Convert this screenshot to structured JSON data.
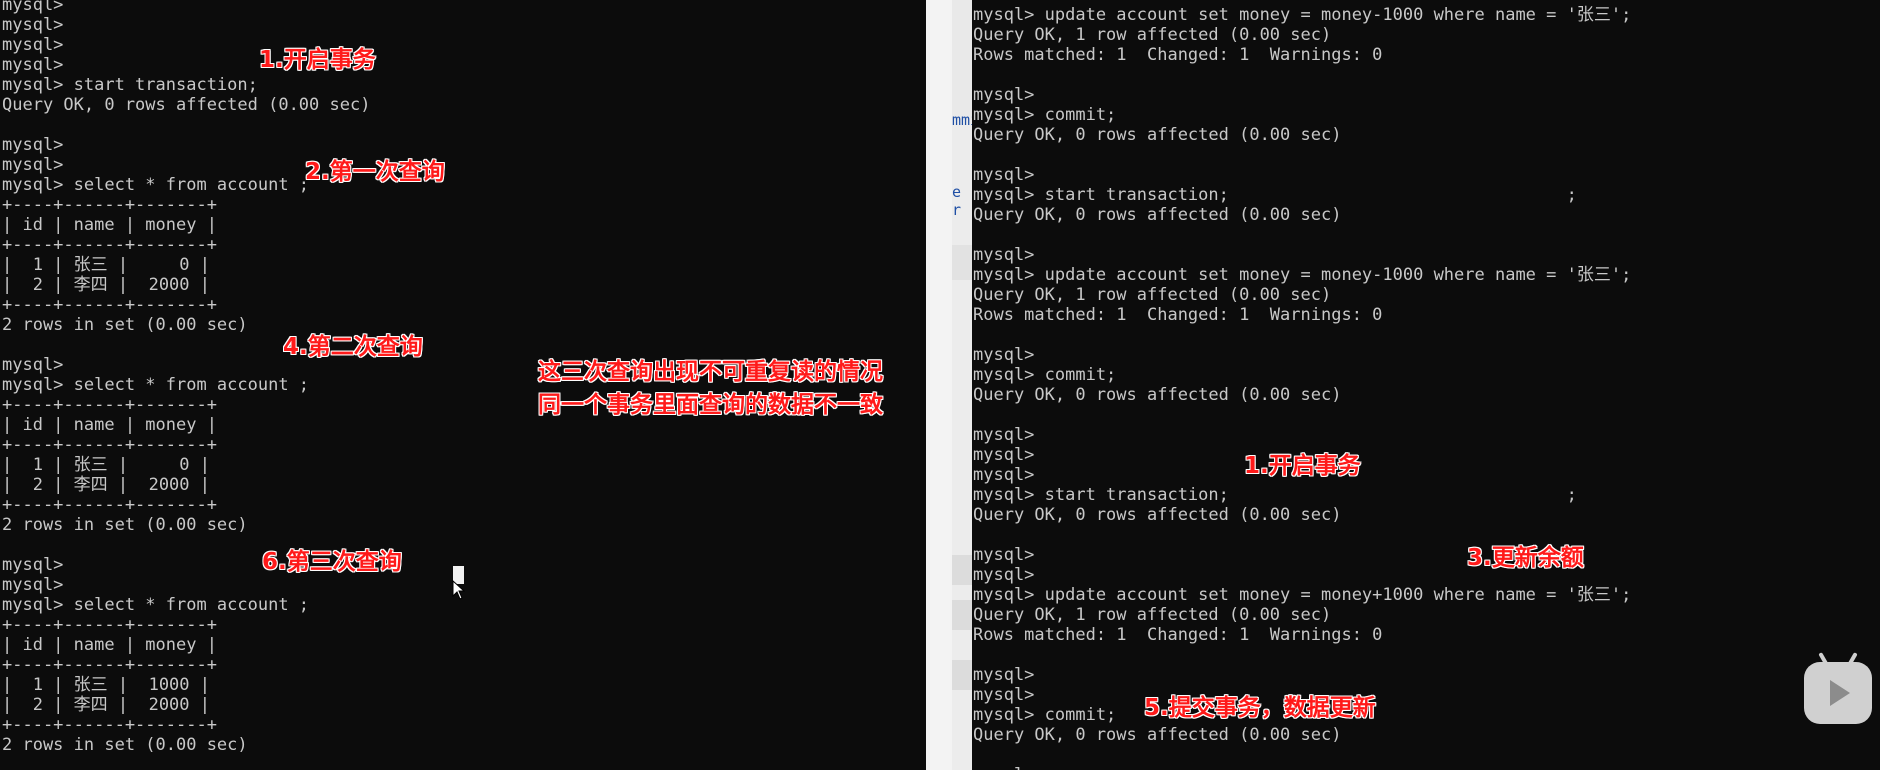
{
  "left_terminal": {
    "lines": [
      "mysql>",
      "mysql>",
      "mysql>",
      "mysql>",
      "mysql> start transaction;",
      "Query OK, 0 rows affected (0.00 sec)",
      "",
      "mysql>",
      "mysql>",
      "mysql> select * from account ;",
      "+----+------+-------+",
      "| id | name | money |",
      "+----+------+-------+",
      "|  1 | 张三 |     0 |",
      "|  2 | 李四 |  2000 |",
      "+----+------+-------+",
      "2 rows in set (0.00 sec)",
      "",
      "mysql>",
      "mysql> select * from account ;",
      "+----+------+-------+",
      "| id | name | money |",
      "+----+------+-------+",
      "|  1 | 张三 |     0 |",
      "|  2 | 李四 |  2000 |",
      "+----+------+-------+",
      "2 rows in set (0.00 sec)",
      "",
      "mysql>",
      "mysql>",
      "mysql> select * from account ;",
      "+----+------+-------+",
      "| id | name | money |",
      "+----+------+-------+",
      "|  1 | 张三 |  1000 |",
      "|  2 | 李四 |  2000 |",
      "+----+------+-------+",
      "2 rows in set (0.00 sec)",
      "",
      "mysql>"
    ]
  },
  "right_terminal": {
    "lines": [
      "mysql> update account set money = money-1000 where name = '张三';",
      "Query OK, 1 row affected (0.00 sec)",
      "Rows matched: 1  Changed: 1  Warnings: 0",
      "",
      "mysql>",
      "mysql> commit;",
      "Query OK, 0 rows affected (0.00 sec)",
      "",
      "mysql>",
      "mysql> start transaction;                                 ;",
      "Query OK, 0 rows affected (0.00 sec)",
      "",
      "mysql>",
      "mysql> update account set money = money-1000 where name = '张三';",
      "Query OK, 1 row affected (0.00 sec)",
      "Rows matched: 1  Changed: 1  Warnings: 0",
      "",
      "mysql>",
      "mysql> commit;",
      "Query OK, 0 rows affected (0.00 sec)",
      "",
      "mysql>",
      "mysql>",
      "mysql>",
      "mysql> start transaction;                                 ;",
      "Query OK, 0 rows affected (0.00 sec)",
      "",
      "mysql>",
      "mysql>",
      "mysql> update account set money = money+1000 where name = '张三';",
      "Query OK, 1 row affected (0.00 sec)",
      "Rows matched: 1  Changed: 1  Warnings: 0",
      "",
      "mysql>",
      "mysql>",
      "mysql> commit;",
      "Query OK, 0 rows affected (0.00 sec)",
      "",
      "mysql>"
    ]
  },
  "editor_fragments": [
    "mmi",
    "e r"
  ],
  "annotations": {
    "left": [
      "1.开启事务",
      "2.第一次查询",
      "4.第二次查询",
      "6.第三次查询",
      "这三次查询出现不可重复读的情况",
      "同一个事务里面查询的数据不一致"
    ],
    "right": [
      "1.开启事务",
      "3.更新余额",
      "5.提交事务，数据更新"
    ]
  },
  "colors": {
    "terminal_bg": "#0c0c0c",
    "terminal_text": "#c8c8c8",
    "annotation": "#ff1a1a"
  },
  "icons": [
    "text-cursor-icon",
    "mouse-pointer-icon",
    "bilibili-play-icon"
  ]
}
